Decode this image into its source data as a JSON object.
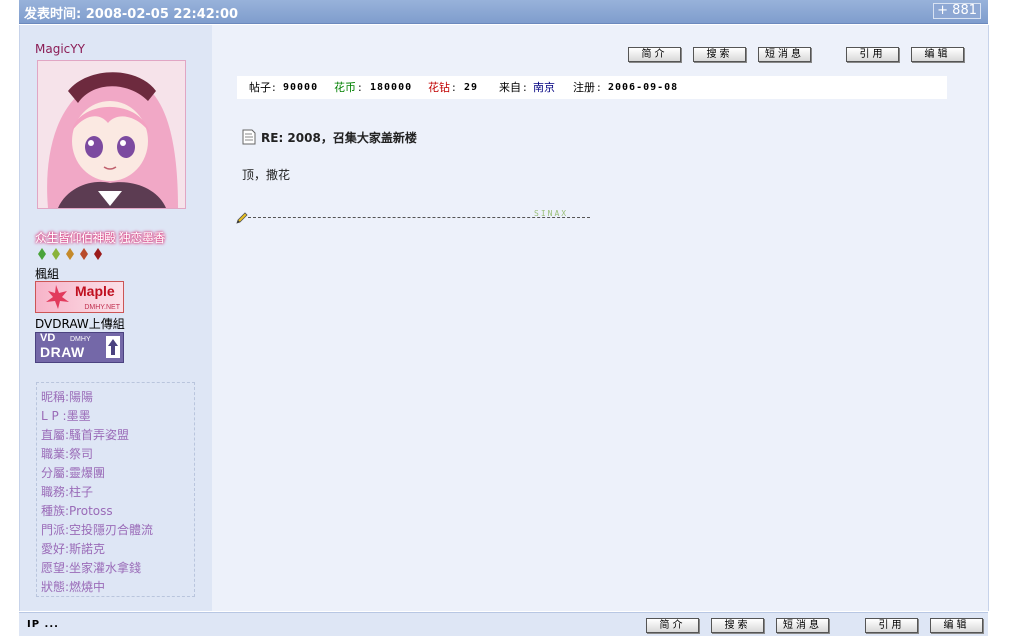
{
  "header": {
    "time_label": "发表时间: 2008-02-05 22:42:00",
    "floor_label": "+ 881"
  },
  "user": {
    "name": "MagicYY",
    "signature_text": "众生皆仰伯神殿  独恋墨香",
    "group1": "楓組",
    "group1_badge": "Maple",
    "group1_badge_sub": "DMHY.NET",
    "group2": "DVDRAW上傳組",
    "group2_badge": "DRAW",
    "group2_badge_vd": "VD",
    "group2_badge_dmhy": "DMHY",
    "profile": [
      "昵稱:陽陽",
      "L P :墨墨",
      "直屬:騷首弄姿盟",
      "職業:祭司",
      "分屬:靈爆團",
      "職務:柱子",
      "種族:Protoss",
      "門派:空投隱刃合體流",
      "愛好:斯諾克",
      "愿望:坐家灌水拿錢",
      "狀態:燃燒中"
    ]
  },
  "toolbar": {
    "profile": "简介",
    "search": "搜索",
    "message": "短消息",
    "quote": "引用",
    "edit": "编辑"
  },
  "stats": {
    "posts_label": "帖子",
    "posts_value": "90000",
    "coins_label": "花币",
    "coins_value": "180000",
    "diamonds_label": "花钻",
    "diamonds_value": "29",
    "from_label": "来自",
    "from_value": "南京",
    "reg_label": "注册",
    "reg_value": "2006-09-08"
  },
  "post": {
    "title": "RE: 2008，召集大家盖新楼",
    "body": "顶，撒花",
    "sig_text": "SINAX"
  },
  "footer": {
    "ip": "IP ..."
  },
  "colors": {
    "header_blue": "#7f9dcd",
    "coins_green": "#008000",
    "diamonds_red": "#c00000",
    "link_navy": "#000080"
  }
}
